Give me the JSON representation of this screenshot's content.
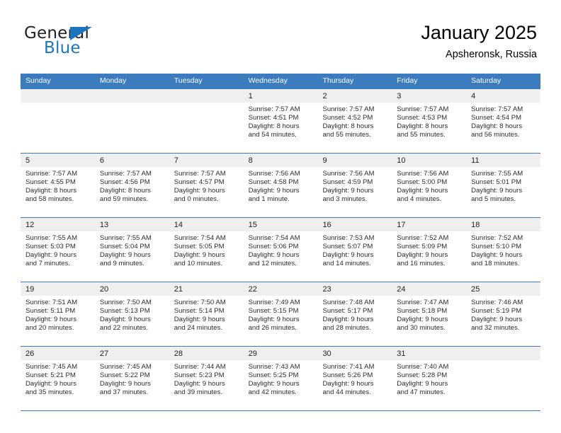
{
  "logo": {
    "word_top": "General",
    "word_bottom": "Blue",
    "triangle_icon": "triangle-icon",
    "brand_color": "#1b76bc"
  },
  "header": {
    "title": "January 2025",
    "subtitle": "Apsheronsk, Russia"
  },
  "theme": {
    "header_band": "#3a7cbe",
    "day_band": "#efefef",
    "text": "#2b2b2b"
  },
  "weekdays": [
    "Sunday",
    "Monday",
    "Tuesday",
    "Wednesday",
    "Thursday",
    "Friday",
    "Saturday"
  ],
  "weeks": [
    [
      {
        "day": "",
        "sunrise": "",
        "sunset": "",
        "daylight_line1": "",
        "daylight_line2": ""
      },
      {
        "day": "",
        "sunrise": "",
        "sunset": "",
        "daylight_line1": "",
        "daylight_line2": ""
      },
      {
        "day": "",
        "sunrise": "",
        "sunset": "",
        "daylight_line1": "",
        "daylight_line2": ""
      },
      {
        "day": "1",
        "sunrise": "Sunrise: 7:57 AM",
        "sunset": "Sunset: 4:51 PM",
        "daylight_line1": "Daylight: 8 hours",
        "daylight_line2": "and 54 minutes."
      },
      {
        "day": "2",
        "sunrise": "Sunrise: 7:57 AM",
        "sunset": "Sunset: 4:52 PM",
        "daylight_line1": "Daylight: 8 hours",
        "daylight_line2": "and 55 minutes."
      },
      {
        "day": "3",
        "sunrise": "Sunrise: 7:57 AM",
        "sunset": "Sunset: 4:53 PM",
        "daylight_line1": "Daylight: 8 hours",
        "daylight_line2": "and 55 minutes."
      },
      {
        "day": "4",
        "sunrise": "Sunrise: 7:57 AM",
        "sunset": "Sunset: 4:54 PM",
        "daylight_line1": "Daylight: 8 hours",
        "daylight_line2": "and 56 minutes."
      }
    ],
    [
      {
        "day": "5",
        "sunrise": "Sunrise: 7:57 AM",
        "sunset": "Sunset: 4:55 PM",
        "daylight_line1": "Daylight: 8 hours",
        "daylight_line2": "and 58 minutes."
      },
      {
        "day": "6",
        "sunrise": "Sunrise: 7:57 AM",
        "sunset": "Sunset: 4:56 PM",
        "daylight_line1": "Daylight: 8 hours",
        "daylight_line2": "and 59 minutes."
      },
      {
        "day": "7",
        "sunrise": "Sunrise: 7:57 AM",
        "sunset": "Sunset: 4:57 PM",
        "daylight_line1": "Daylight: 9 hours",
        "daylight_line2": "and 0 minutes."
      },
      {
        "day": "8",
        "sunrise": "Sunrise: 7:56 AM",
        "sunset": "Sunset: 4:58 PM",
        "daylight_line1": "Daylight: 9 hours",
        "daylight_line2": "and 1 minute."
      },
      {
        "day": "9",
        "sunrise": "Sunrise: 7:56 AM",
        "sunset": "Sunset: 4:59 PM",
        "daylight_line1": "Daylight: 9 hours",
        "daylight_line2": "and 3 minutes."
      },
      {
        "day": "10",
        "sunrise": "Sunrise: 7:56 AM",
        "sunset": "Sunset: 5:00 PM",
        "daylight_line1": "Daylight: 9 hours",
        "daylight_line2": "and 4 minutes."
      },
      {
        "day": "11",
        "sunrise": "Sunrise: 7:55 AM",
        "sunset": "Sunset: 5:01 PM",
        "daylight_line1": "Daylight: 9 hours",
        "daylight_line2": "and 5 minutes."
      }
    ],
    [
      {
        "day": "12",
        "sunrise": "Sunrise: 7:55 AM",
        "sunset": "Sunset: 5:03 PM",
        "daylight_line1": "Daylight: 9 hours",
        "daylight_line2": "and 7 minutes."
      },
      {
        "day": "13",
        "sunrise": "Sunrise: 7:55 AM",
        "sunset": "Sunset: 5:04 PM",
        "daylight_line1": "Daylight: 9 hours",
        "daylight_line2": "and 9 minutes."
      },
      {
        "day": "14",
        "sunrise": "Sunrise: 7:54 AM",
        "sunset": "Sunset: 5:05 PM",
        "daylight_line1": "Daylight: 9 hours",
        "daylight_line2": "and 10 minutes."
      },
      {
        "day": "15",
        "sunrise": "Sunrise: 7:54 AM",
        "sunset": "Sunset: 5:06 PM",
        "daylight_line1": "Daylight: 9 hours",
        "daylight_line2": "and 12 minutes."
      },
      {
        "day": "16",
        "sunrise": "Sunrise: 7:53 AM",
        "sunset": "Sunset: 5:07 PM",
        "daylight_line1": "Daylight: 9 hours",
        "daylight_line2": "and 14 minutes."
      },
      {
        "day": "17",
        "sunrise": "Sunrise: 7:52 AM",
        "sunset": "Sunset: 5:09 PM",
        "daylight_line1": "Daylight: 9 hours",
        "daylight_line2": "and 16 minutes."
      },
      {
        "day": "18",
        "sunrise": "Sunrise: 7:52 AM",
        "sunset": "Sunset: 5:10 PM",
        "daylight_line1": "Daylight: 9 hours",
        "daylight_line2": "and 18 minutes."
      }
    ],
    [
      {
        "day": "19",
        "sunrise": "Sunrise: 7:51 AM",
        "sunset": "Sunset: 5:11 PM",
        "daylight_line1": "Daylight: 9 hours",
        "daylight_line2": "and 20 minutes."
      },
      {
        "day": "20",
        "sunrise": "Sunrise: 7:50 AM",
        "sunset": "Sunset: 5:13 PM",
        "daylight_line1": "Daylight: 9 hours",
        "daylight_line2": "and 22 minutes."
      },
      {
        "day": "21",
        "sunrise": "Sunrise: 7:50 AM",
        "sunset": "Sunset: 5:14 PM",
        "daylight_line1": "Daylight: 9 hours",
        "daylight_line2": "and 24 minutes."
      },
      {
        "day": "22",
        "sunrise": "Sunrise: 7:49 AM",
        "sunset": "Sunset: 5:15 PM",
        "daylight_line1": "Daylight: 9 hours",
        "daylight_line2": "and 26 minutes."
      },
      {
        "day": "23",
        "sunrise": "Sunrise: 7:48 AM",
        "sunset": "Sunset: 5:17 PM",
        "daylight_line1": "Daylight: 9 hours",
        "daylight_line2": "and 28 minutes."
      },
      {
        "day": "24",
        "sunrise": "Sunrise: 7:47 AM",
        "sunset": "Sunset: 5:18 PM",
        "daylight_line1": "Daylight: 9 hours",
        "daylight_line2": "and 30 minutes."
      },
      {
        "day": "25",
        "sunrise": "Sunrise: 7:46 AM",
        "sunset": "Sunset: 5:19 PM",
        "daylight_line1": "Daylight: 9 hours",
        "daylight_line2": "and 32 minutes."
      }
    ],
    [
      {
        "day": "26",
        "sunrise": "Sunrise: 7:45 AM",
        "sunset": "Sunset: 5:21 PM",
        "daylight_line1": "Daylight: 9 hours",
        "daylight_line2": "and 35 minutes."
      },
      {
        "day": "27",
        "sunrise": "Sunrise: 7:45 AM",
        "sunset": "Sunset: 5:22 PM",
        "daylight_line1": "Daylight: 9 hours",
        "daylight_line2": "and 37 minutes."
      },
      {
        "day": "28",
        "sunrise": "Sunrise: 7:44 AM",
        "sunset": "Sunset: 5:23 PM",
        "daylight_line1": "Daylight: 9 hours",
        "daylight_line2": "and 39 minutes."
      },
      {
        "day": "29",
        "sunrise": "Sunrise: 7:43 AM",
        "sunset": "Sunset: 5:25 PM",
        "daylight_line1": "Daylight: 9 hours",
        "daylight_line2": "and 42 minutes."
      },
      {
        "day": "30",
        "sunrise": "Sunrise: 7:41 AM",
        "sunset": "Sunset: 5:26 PM",
        "daylight_line1": "Daylight: 9 hours",
        "daylight_line2": "and 44 minutes."
      },
      {
        "day": "31",
        "sunrise": "Sunrise: 7:40 AM",
        "sunset": "Sunset: 5:28 PM",
        "daylight_line1": "Daylight: 9 hours",
        "daylight_line2": "and 47 minutes."
      },
      {
        "day": "",
        "sunrise": "",
        "sunset": "",
        "daylight_line1": "",
        "daylight_line2": ""
      }
    ]
  ]
}
